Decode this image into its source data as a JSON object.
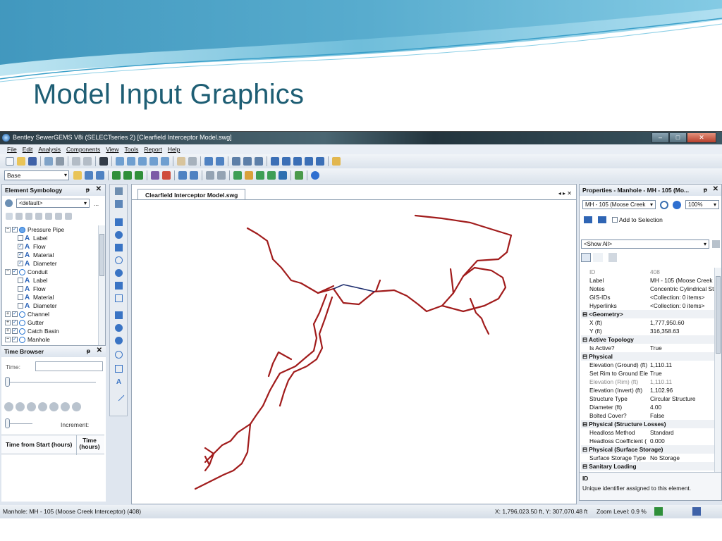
{
  "slide": {
    "title": "Model Input Graphics"
  },
  "window": {
    "title": "Bentley SewerGEMS V8i (SELECTseries 2) [Clearfield Interceptor Model.swg]",
    "controls": {
      "minimize": "–",
      "maximize": "□",
      "close": "✕"
    }
  },
  "menu": [
    "File",
    "Edit",
    "Analysis",
    "Components",
    "View",
    "Tools",
    "Report",
    "Help"
  ],
  "toolbar": {
    "base_select": "Base"
  },
  "element_symbology": {
    "title": "Element Symbology",
    "pin": "ᵽ",
    "close": "✕",
    "dropdown": "<default>",
    "more": "...",
    "tree": [
      {
        "level": 0,
        "expander": "−",
        "checked": true,
        "icon": "pressure-pipe-icon",
        "label": "Pressure Pipe"
      },
      {
        "level": 1,
        "checked": false,
        "icon": "annotation-icon",
        "label": "Label"
      },
      {
        "level": 1,
        "checked": true,
        "icon": "annotation-icon",
        "label": "Flow"
      },
      {
        "level": 1,
        "checked": true,
        "icon": "annotation-icon",
        "label": "Material"
      },
      {
        "level": 1,
        "checked": true,
        "icon": "annotation-icon",
        "label": "Diameter"
      },
      {
        "level": 0,
        "expander": "−",
        "checked": true,
        "icon": "conduit-icon",
        "label": "Conduit"
      },
      {
        "level": 1,
        "checked": false,
        "icon": "annotation-icon",
        "label": "Label"
      },
      {
        "level": 1,
        "checked": false,
        "icon": "annotation-icon",
        "label": "Flow"
      },
      {
        "level": 1,
        "checked": false,
        "icon": "annotation-icon",
        "label": "Material"
      },
      {
        "level": 1,
        "checked": false,
        "icon": "annotation-icon",
        "label": "Diameter"
      },
      {
        "level": 0,
        "expander": "+",
        "checked": true,
        "icon": "channel-icon",
        "label": "Channel"
      },
      {
        "level": 0,
        "expander": "+",
        "checked": true,
        "icon": "gutter-icon",
        "label": "Gutter"
      },
      {
        "level": 0,
        "expander": "+",
        "checked": true,
        "icon": "catch-basin-icon",
        "label": "Catch Basin"
      },
      {
        "level": 0,
        "expander": "−",
        "checked": true,
        "icon": "manhole-icon",
        "label": "Manhole"
      }
    ]
  },
  "time_browser": {
    "title": "Time Browser",
    "pin": "ᵽ",
    "close": "✕",
    "time_label": "Time:",
    "time_value": "",
    "increment_label": "Increment:",
    "col1": "Time from Start (hours)",
    "col2": "Time (hours)"
  },
  "document": {
    "tab": "Clearfield Interceptor Model.swg",
    "nav": "◂ ▸ ✕"
  },
  "properties": {
    "title": "Properties - Manhole - MH - 105 (Mo...",
    "pin": "ᵽ",
    "close": "✕",
    "element_select": "MH - 105 (Moose Creek",
    "zoom_select": "100%",
    "add_to_selection": "Add to Selection",
    "filter_select": "<Show All>",
    "rows": [
      {
        "type": "prop",
        "name": "ID",
        "value": "408",
        "gray": true
      },
      {
        "type": "prop",
        "name": "Label",
        "value": "MH - 105 (Moose Creek In"
      },
      {
        "type": "prop",
        "name": "Notes",
        "value": "Concentric Cylindrical Stru"
      },
      {
        "type": "prop",
        "name": "GIS-IDs",
        "value": "<Collection: 0 items>"
      },
      {
        "type": "prop",
        "name": "Hyperlinks",
        "value": "<Collection: 0 items>"
      },
      {
        "type": "cat",
        "name": "<Geometry>"
      },
      {
        "type": "prop",
        "name": "X (ft)",
        "value": "1,777,950.60"
      },
      {
        "type": "prop",
        "name": "Y (ft)",
        "value": "316,358.63"
      },
      {
        "type": "cat",
        "name": "Active Topology"
      },
      {
        "type": "prop",
        "name": "Is Active?",
        "value": "True"
      },
      {
        "type": "cat",
        "name": "Physical"
      },
      {
        "type": "prop",
        "name": "Elevation (Ground) (ft)",
        "value": "1,110.11"
      },
      {
        "type": "prop",
        "name": "Set Rim to Ground Ele",
        "value": "True"
      },
      {
        "type": "prop",
        "name": "Elevation (Rim) (ft)",
        "value": "1,110.11",
        "gray": true
      },
      {
        "type": "prop",
        "name": "Elevation (Invert) (ft)",
        "value": "1,102.96"
      },
      {
        "type": "prop",
        "name": "Structure Type",
        "value": "Circular Structure"
      },
      {
        "type": "prop",
        "name": "Diameter (ft)",
        "value": "4.00"
      },
      {
        "type": "prop",
        "name": "Bolted Cover?",
        "value": "False"
      },
      {
        "type": "cat",
        "name": "Physical (Structure Losses)"
      },
      {
        "type": "prop",
        "name": "Headloss Method",
        "value": "Standard"
      },
      {
        "type": "prop",
        "name": "Headloss Coefficient (",
        "value": "0.000"
      },
      {
        "type": "cat",
        "name": "Physical (Surface Storage)"
      },
      {
        "type": "prop",
        "name": "Surface Storage Type",
        "value": "No Storage"
      },
      {
        "type": "cat",
        "name": "Sanitary Loading"
      }
    ],
    "description_title": "ID",
    "description_text": "Unique identifier assigned to this element."
  },
  "statusbar": {
    "selection": "Manhole:  MH - 105 (Moose Creek Interceptor) (408)",
    "coords": "X: 1,796,023.50 ft, Y: 307,070.48 ft",
    "zoom": "Zoom Level: 0.9 %"
  },
  "colors": {
    "pipe": "#a11c1c",
    "title": "#1e5e74",
    "selected_pipe": "#1a2a6c"
  }
}
